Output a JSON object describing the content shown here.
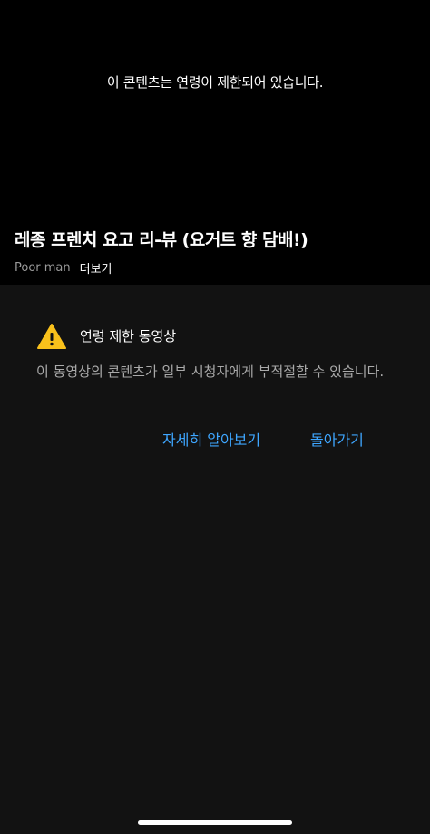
{
  "player": {
    "restriction_message": "이 콘텐츠는 연령이 제한되어 있습니다."
  },
  "video": {
    "title": "레종 프렌치 요고 리-뷰 (요거트 향 담배!)",
    "channel": "Poor man",
    "more_label": "더보기"
  },
  "dialog": {
    "icon": "warning-icon",
    "icon_color": "#f9c11b",
    "title": "연령 제한 동영상",
    "body": "이 동영상의 콘텐츠가 일부 시청자에게 부적절할 수 있습니다.",
    "learn_more_label": "자세히 알아보기",
    "go_back_label": "돌아가기",
    "accent_color": "#3ea6ff"
  }
}
